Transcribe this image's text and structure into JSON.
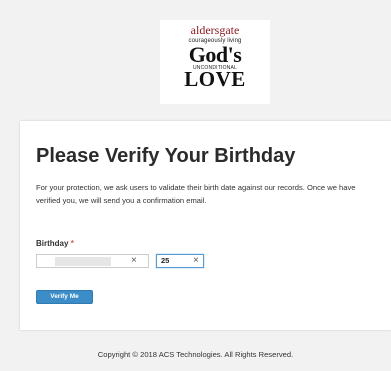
{
  "logo": {
    "top_text": "aldersgate",
    "sub_text": "courageously living",
    "gods_text": "God's",
    "unconditional_text": "UNCONDITIONAL",
    "love_text": "LOVE"
  },
  "card": {
    "title": "Please Verify Your Birthday",
    "description": "For your protection, we ask users to validate their birth date against our records. Once we have verified you, we will send you a confirmation email.",
    "birthday_label": "Birthday",
    "required_mark": "*",
    "month_clear": "×",
    "day_value": "25",
    "day_clear": "×",
    "verify_button": "Verify Me"
  },
  "footer": {
    "copyright": "Copyright © 2018 ACS Technologies. All Rights Reserved."
  },
  "colors": {
    "page_bg": "#f2f2f2",
    "button_blue": "#3b8cc7",
    "logo_red": "#8a1c24",
    "required_red": "#d9534f",
    "focus_blue": "#5b9bd5"
  }
}
